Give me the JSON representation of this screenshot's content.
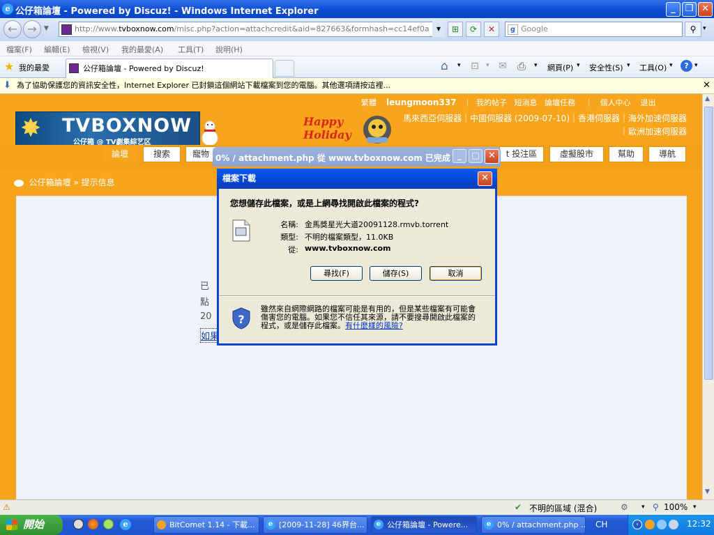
{
  "window": {
    "title": "公仔箱論壇 - Powered by Discuz! - Windows Internet Explorer"
  },
  "address": {
    "url_prefix": "http://www.",
    "url_domain": "tvboxnow.com",
    "url_rest": "/misc.php?action=attachcredit&aid=827663&formhash=cc14ef0a",
    "search_placeholder": "Google"
  },
  "menu": [
    "檔案(F)",
    "編輯(E)",
    "檢視(V)",
    "我的最愛(A)",
    "工具(T)",
    "說明(H)"
  ],
  "favbar": {
    "favorites_label": "我的最愛",
    "tab_label": "公仔箱論壇 - Powered by Discuz!",
    "page_menu": "網頁(P)",
    "safety_menu": "安全性(S)",
    "tools_menu": "工具(O)"
  },
  "infobar": {
    "text": "為了協助保護您的資訊安全性，Internet Explorer 已封鎖這個網站下載檔案到您的電腦。其他選項請按這裡..."
  },
  "site": {
    "top_links": {
      "traditional": "繁體",
      "username": "leungmoon337",
      "my_posts": "我的帖子",
      "messages": "短消息",
      "tasks": "論壇任務",
      "profile": "個人中心",
      "logout": "退出"
    },
    "logo_text": "TVBOXNOW",
    "logo_subtitle": "公仔箱 @ TV劇集綜艺区",
    "holiday_line1": "Happy",
    "holiday_line2": "Holiday",
    "servers_line1": "馬來西亞伺服器｜中國伺服器 (2009-07-10)｜香港伺服器｜海外加速伺服器",
    "servers_line2": "｜歐洲加速伺服器",
    "nav": {
      "forum": "論壇",
      "search": "搜索",
      "pets": "寵物",
      "submit": "t 投注區",
      "stocks": "虛擬股市",
      "help": "幫助",
      "guide": "導航"
    },
    "breadcrumb_home": "公仔箱論壇",
    "breadcrumb_sep": "»",
    "breadcrumb_current": "提示信息",
    "partial_text": [
      "已",
      "點",
      "20",
      "如果"
    ]
  },
  "progress_dialog": {
    "title": "0% / attachment.php 從 www.tvboxnow.com 已完成"
  },
  "download_dialog": {
    "title": "檔案下載",
    "question": "您想儲存此檔案，或是上網尋找開啟此檔案的程式?",
    "name_label": "名稱:",
    "name_value": "金馬獎星光大道20091128.rmvb.torrent",
    "type_label": "類型:",
    "type_value": "不明的檔案類型，11.0KB",
    "from_label": "從:",
    "from_value": "www.tvboxnow.com",
    "find_button": "尋找(F)",
    "save_button": "儲存(S)",
    "cancel_button": "取消",
    "warning_text": "雖然來自網際網路的檔案可能是有用的，但是某些檔案有可能會傷害您的電腦。如果您不信任其來源，請不要搜尋開啟此檔案的程式，或是儲存此檔案。",
    "risk_link": "有什麼樣的風險?"
  },
  "status": {
    "zone": "不明的區域 (混合)",
    "zoom": "100%"
  },
  "taskbar": {
    "start": "開始",
    "tasks": [
      "BitComet 1.14 - 下載...",
      "[2009-11-28] 46界台...",
      "公仔箱論壇 - Powere...",
      "0% / attachment.php ..."
    ],
    "lang": "CH",
    "clock": "12:32"
  }
}
